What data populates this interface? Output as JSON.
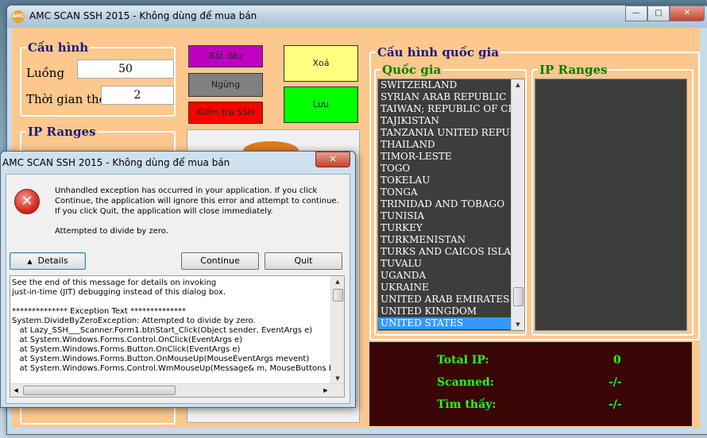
{
  "window": {
    "title": "AMC SCAN SSH  2015 - Không dùng để mua bán",
    "icon_text": "AMC",
    "buttons": {
      "minimize": "—",
      "maximize": "□",
      "close": "✕"
    }
  },
  "config": {
    "legend": "Cấu hình",
    "threads_label": "Luồng",
    "threads_value": "50",
    "timeout_label": "Thời gian thoát",
    "timeout_value": "2"
  },
  "actions": {
    "start": "Bắt đầu",
    "stop": "Ngừng",
    "check_ssh": "Kiểm tra SSH",
    "delete": "Xoá",
    "save": "Lưu"
  },
  "colors": {
    "start": "#c000c0",
    "stop": "#808080",
    "check_ssh": "#ff0000",
    "delete": "#ffff80",
    "save": "#00ff00",
    "form_bg": "#fcc88e",
    "list_bg": "#3d3d3d",
    "selected": "#3399ff",
    "stats_bg": "#3a0505",
    "stats_text": "#22ff22"
  },
  "left_ip_ranges": {
    "legend": "IP Ranges"
  },
  "country_config": {
    "legend": "Cấu hình quốc gia",
    "country_legend": "Quốc gia",
    "ip_ranges_legend": "IP Ranges",
    "countries": [
      "SWITZERLAND",
      "SYRIAN ARAB REPUBLIC",
      "TAIWAN; REPUBLIC OF CHIN",
      "TAJIKISTAN",
      "TANZANIA UNITED REPUBL",
      "THAILAND",
      "TIMOR-LESTE",
      "TOGO",
      "TOKELAU",
      "TONGA",
      "TRINIDAD AND TOBAGO",
      "TUNISIA",
      "TURKEY",
      "TURKMENISTAN",
      "TURKS AND CAICOS ISLANI",
      "TUVALU",
      "UGANDA",
      "UKRAINE",
      "UNITED ARAB EMIRATES",
      "UNITED KINGDOM",
      "UNITED STATES"
    ],
    "selected_country": "UNITED STATES"
  },
  "stats": {
    "total_label": "Total IP:",
    "total_value": "0",
    "scanned_label": "Scanned:",
    "scanned_value": "-/-",
    "found_label": "Tìm thấy:",
    "found_value": "-/-"
  },
  "dialog": {
    "title": "AMC SCAN SSH  2015 - Không dùng để mua bán",
    "close": "✕",
    "message": "Unhandled exception has occurred in your application. If you click Continue, the application will ignore this error and attempt to continue. If you click Quit, the application will close immediately.",
    "detail_message": "Attempted to divide by zero.",
    "details_button": "Details",
    "continue_button": "Continue",
    "quit_button": "Quit",
    "detail_lines": [
      "See the end of this message for details on invoking",
      "just-in-time (JIT) debugging instead of this dialog box.",
      "",
      "************** Exception Text **************",
      "System.DivideByZeroException: Attempted to divide by zero.",
      "   at Lazy_SSH___Scanner.Form1.btnStart_Click(Object sender, EventArgs e)",
      "   at System.Windows.Forms.Control.OnClick(EventArgs e)",
      "   at System.Windows.Forms.Button.OnClick(EventArgs e)",
      "   at System.Windows.Forms.Button.OnMouseUp(MouseEventArgs mevent)",
      "   at System.Windows.Forms.Control.WmMouseUp(Message& m, MouseButtons butto"
    ]
  }
}
